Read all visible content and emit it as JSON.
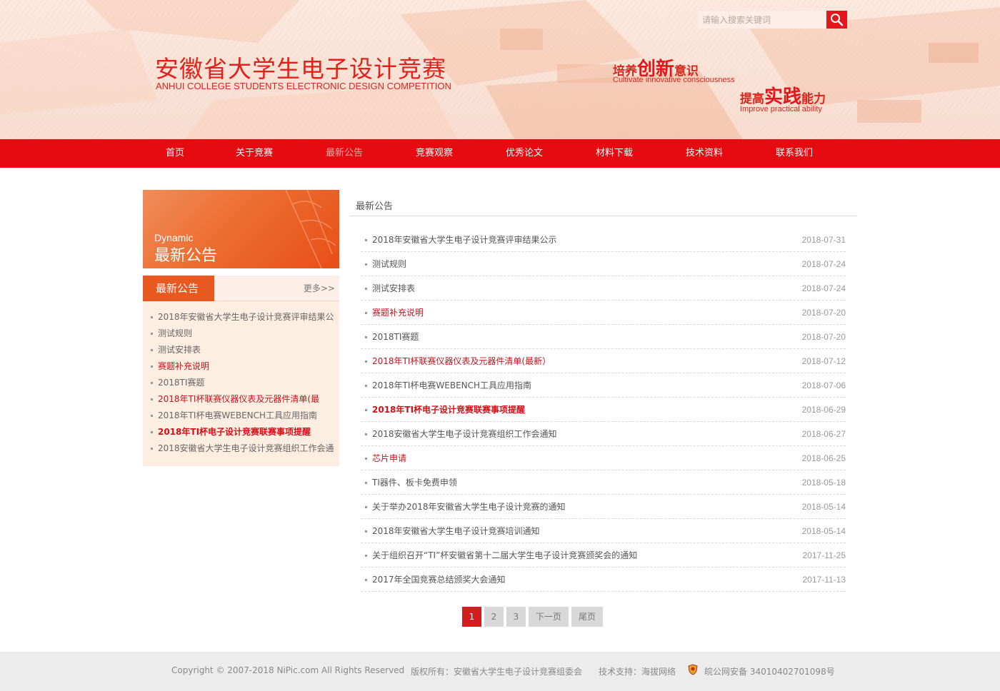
{
  "header": {
    "title": "安徽省大学生电子设计竞赛",
    "subtitle": "ANHUI COLLEGE STUDENTS ELECTRONIC DESIGN COMPETITION",
    "search_placeholder": "请输入搜索关键词",
    "slogan1": {
      "a": "培养",
      "b": "创新",
      "c": "意识",
      "en": "Cultivate innovative consciousness"
    },
    "slogan2": {
      "a": "提高",
      "b": "实践",
      "c": "能力",
      "en": "Improve practical ability"
    }
  },
  "nav": {
    "items": [
      {
        "label": "首页",
        "active": false
      },
      {
        "label": "关于竞赛",
        "active": false
      },
      {
        "label": "最新公告",
        "active": true
      },
      {
        "label": "竞赛观察",
        "active": false
      },
      {
        "label": "优秀论文",
        "active": false
      },
      {
        "label": "材料下载",
        "active": false
      },
      {
        "label": "技术资料",
        "active": false
      },
      {
        "label": "联系我们",
        "active": false
      }
    ]
  },
  "sidebar": {
    "banner_en": "Dynamic",
    "banner_cn": "最新公告",
    "box_title": "最新公告",
    "more": "更多>>",
    "items": [
      {
        "label": "2018年安徽省大学生电子设计竞赛评审结果公",
        "style": "normal"
      },
      {
        "label": "测试规则",
        "style": "normal"
      },
      {
        "label": "测试安排表",
        "style": "normal"
      },
      {
        "label": "赛题补充说明",
        "style": "red"
      },
      {
        "label": "2018TI赛题",
        "style": "normal"
      },
      {
        "label": "2018年TI杯联赛仪器仪表及元器件清单(最",
        "style": "red"
      },
      {
        "label": "2018年TI杯电赛WEBENCH工具应用指南",
        "style": "normal"
      },
      {
        "label": "2018年TI杯电子设计竞赛联赛事项提醒",
        "style": "bold"
      },
      {
        "label": "2018安徽省大学生电子设计竞赛组织工作会通",
        "style": "normal"
      }
    ]
  },
  "main": {
    "title": "最新公告",
    "news": [
      {
        "title": "2018年安徽省大学生电子设计竞赛评审结果公示",
        "date": "2018-07-31",
        "style": "normal"
      },
      {
        "title": "测试规则",
        "date": "2018-07-24",
        "style": "normal"
      },
      {
        "title": "测试安排表",
        "date": "2018-07-24",
        "style": "normal"
      },
      {
        "title": "赛题补充说明",
        "date": "2018-07-20",
        "style": "red"
      },
      {
        "title": "2018TI赛题",
        "date": "2018-07-20",
        "style": "normal"
      },
      {
        "title": "2018年TI杯联赛仪器仪表及元器件清单(最新）",
        "date": "2018-07-12",
        "style": "red"
      },
      {
        "title": "2018年TI杯电赛WEBENCH工具应用指南",
        "date": "2018-07-06",
        "style": "normal"
      },
      {
        "title": "2018年TI杯电子设计竞赛联赛事项提醒",
        "date": "2018-06-29",
        "style": "bold"
      },
      {
        "title": "2018安徽省大学生电子设计竞赛组织工作会通知",
        "date": "2018-06-27",
        "style": "normal"
      },
      {
        "title": "芯片申请",
        "date": "2018-06-25",
        "style": "red"
      },
      {
        "title": "TI器件、板卡免费申领",
        "date": "2018-05-18",
        "style": "normal"
      },
      {
        "title": "关于举办2018年安徽省大学生电子设计竞赛的通知",
        "date": "2018-05-14",
        "style": "normal"
      },
      {
        "title": "2018年安徽省大学生电子设计竞赛培训通知",
        "date": "2018-05-14",
        "style": "normal"
      },
      {
        "title": "关于组织召开“TI”杯安徽省第十二届大学生电子设计竞赛颁奖会的通知",
        "date": "2017-11-25",
        "style": "normal"
      },
      {
        "title": "2017年全国竞赛总结颁奖大会通知",
        "date": "2017-11-13",
        "style": "normal"
      }
    ]
  },
  "pager": {
    "pages": [
      "1",
      "2",
      "3"
    ],
    "current": "1",
    "next": "下一页",
    "last": "尾页"
  },
  "footer": {
    "copyright": "Copyright © 2007-2018 NiPic.com All Rights Reserved",
    "owner": "版权所有：安徽省大学生电子设计竞赛组委会",
    "support": "技术支持：海拔网络",
    "icp": "皖公网安备 34010402701098号"
  },
  "colors": {
    "brand_red": "#e50b10",
    "accent_orange": "#e8581f",
    "link_red": "#c0141e"
  }
}
